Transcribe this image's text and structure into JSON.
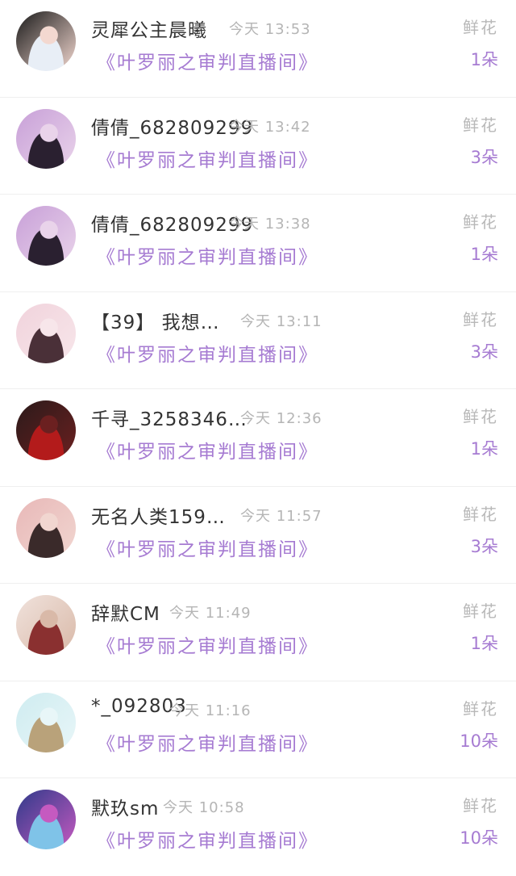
{
  "rows": [
    {
      "user": "灵犀公主晨曦",
      "time": "今天 13:53",
      "room": "《叶罗丽之审判直播间》",
      "gift": "鲜花",
      "count": "1朵",
      "avatar_colors": [
        "#1a1a1a",
        "#e8eef6",
        "#f3d8d0"
      ]
    },
    {
      "user": "倩倩_682809299",
      "time": "今天 13:42",
      "room": "《叶罗丽之审判直播间》",
      "gift": "鲜花",
      "count": "3朵",
      "avatar_colors": [
        "#c8a0d8",
        "#2a2030",
        "#e9d3ea"
      ]
    },
    {
      "user": "倩倩_682809299",
      "time": "今天 13:38",
      "room": "《叶罗丽之审判直播间》",
      "gift": "鲜花",
      "count": "1朵",
      "avatar_colors": [
        "#c8a0d8",
        "#2a2030",
        "#e9d3ea"
      ]
    },
    {
      "user": "【39】 我想…",
      "time": "今天 13:11",
      "room": "《叶罗丽之审判直播间》",
      "gift": "鲜花",
      "count": "3朵",
      "avatar_colors": [
        "#f1d3dc",
        "#4a3038",
        "#f7e6ea"
      ]
    },
    {
      "user": "千寻_3258346…",
      "time": "今天 12:36",
      "room": "《叶罗丽之审判直播间》",
      "gift": "鲜花",
      "count": "1朵",
      "avatar_colors": [
        "#2b1a1a",
        "#b31b1b",
        "#6b2020"
      ]
    },
    {
      "user": "无名人类159…",
      "time": "今天 11:57",
      "room": "《叶罗丽之审判直播间》",
      "gift": "鲜花",
      "count": "3朵",
      "avatar_colors": [
        "#e8b8b8",
        "#3a2a2a",
        "#f1d6d0"
      ]
    },
    {
      "user": "辞默CM",
      "time": "今天 11:49",
      "room": "《叶罗丽之审判直播间》",
      "gift": "鲜花",
      "count": "1朵",
      "avatar_colors": [
        "#f0e2dc",
        "#8a3030",
        "#d9b9a8"
      ]
    },
    {
      "user": "*_092803",
      "time": "今天 11:16",
      "room": "《叶罗丽之审判直播间》",
      "gift": "鲜花",
      "count": "10朵",
      "avatar_colors": [
        "#cfecf0",
        "#b9a27a",
        "#e8f6f8"
      ]
    },
    {
      "user": "默玖sm",
      "time": "今天 10:58",
      "room": "《叶罗丽之审判直播间》",
      "gift": "鲜花",
      "count": "10朵",
      "avatar_colors": [
        "#2f3a8a",
        "#7fc3e8",
        "#c55ac0"
      ]
    }
  ]
}
